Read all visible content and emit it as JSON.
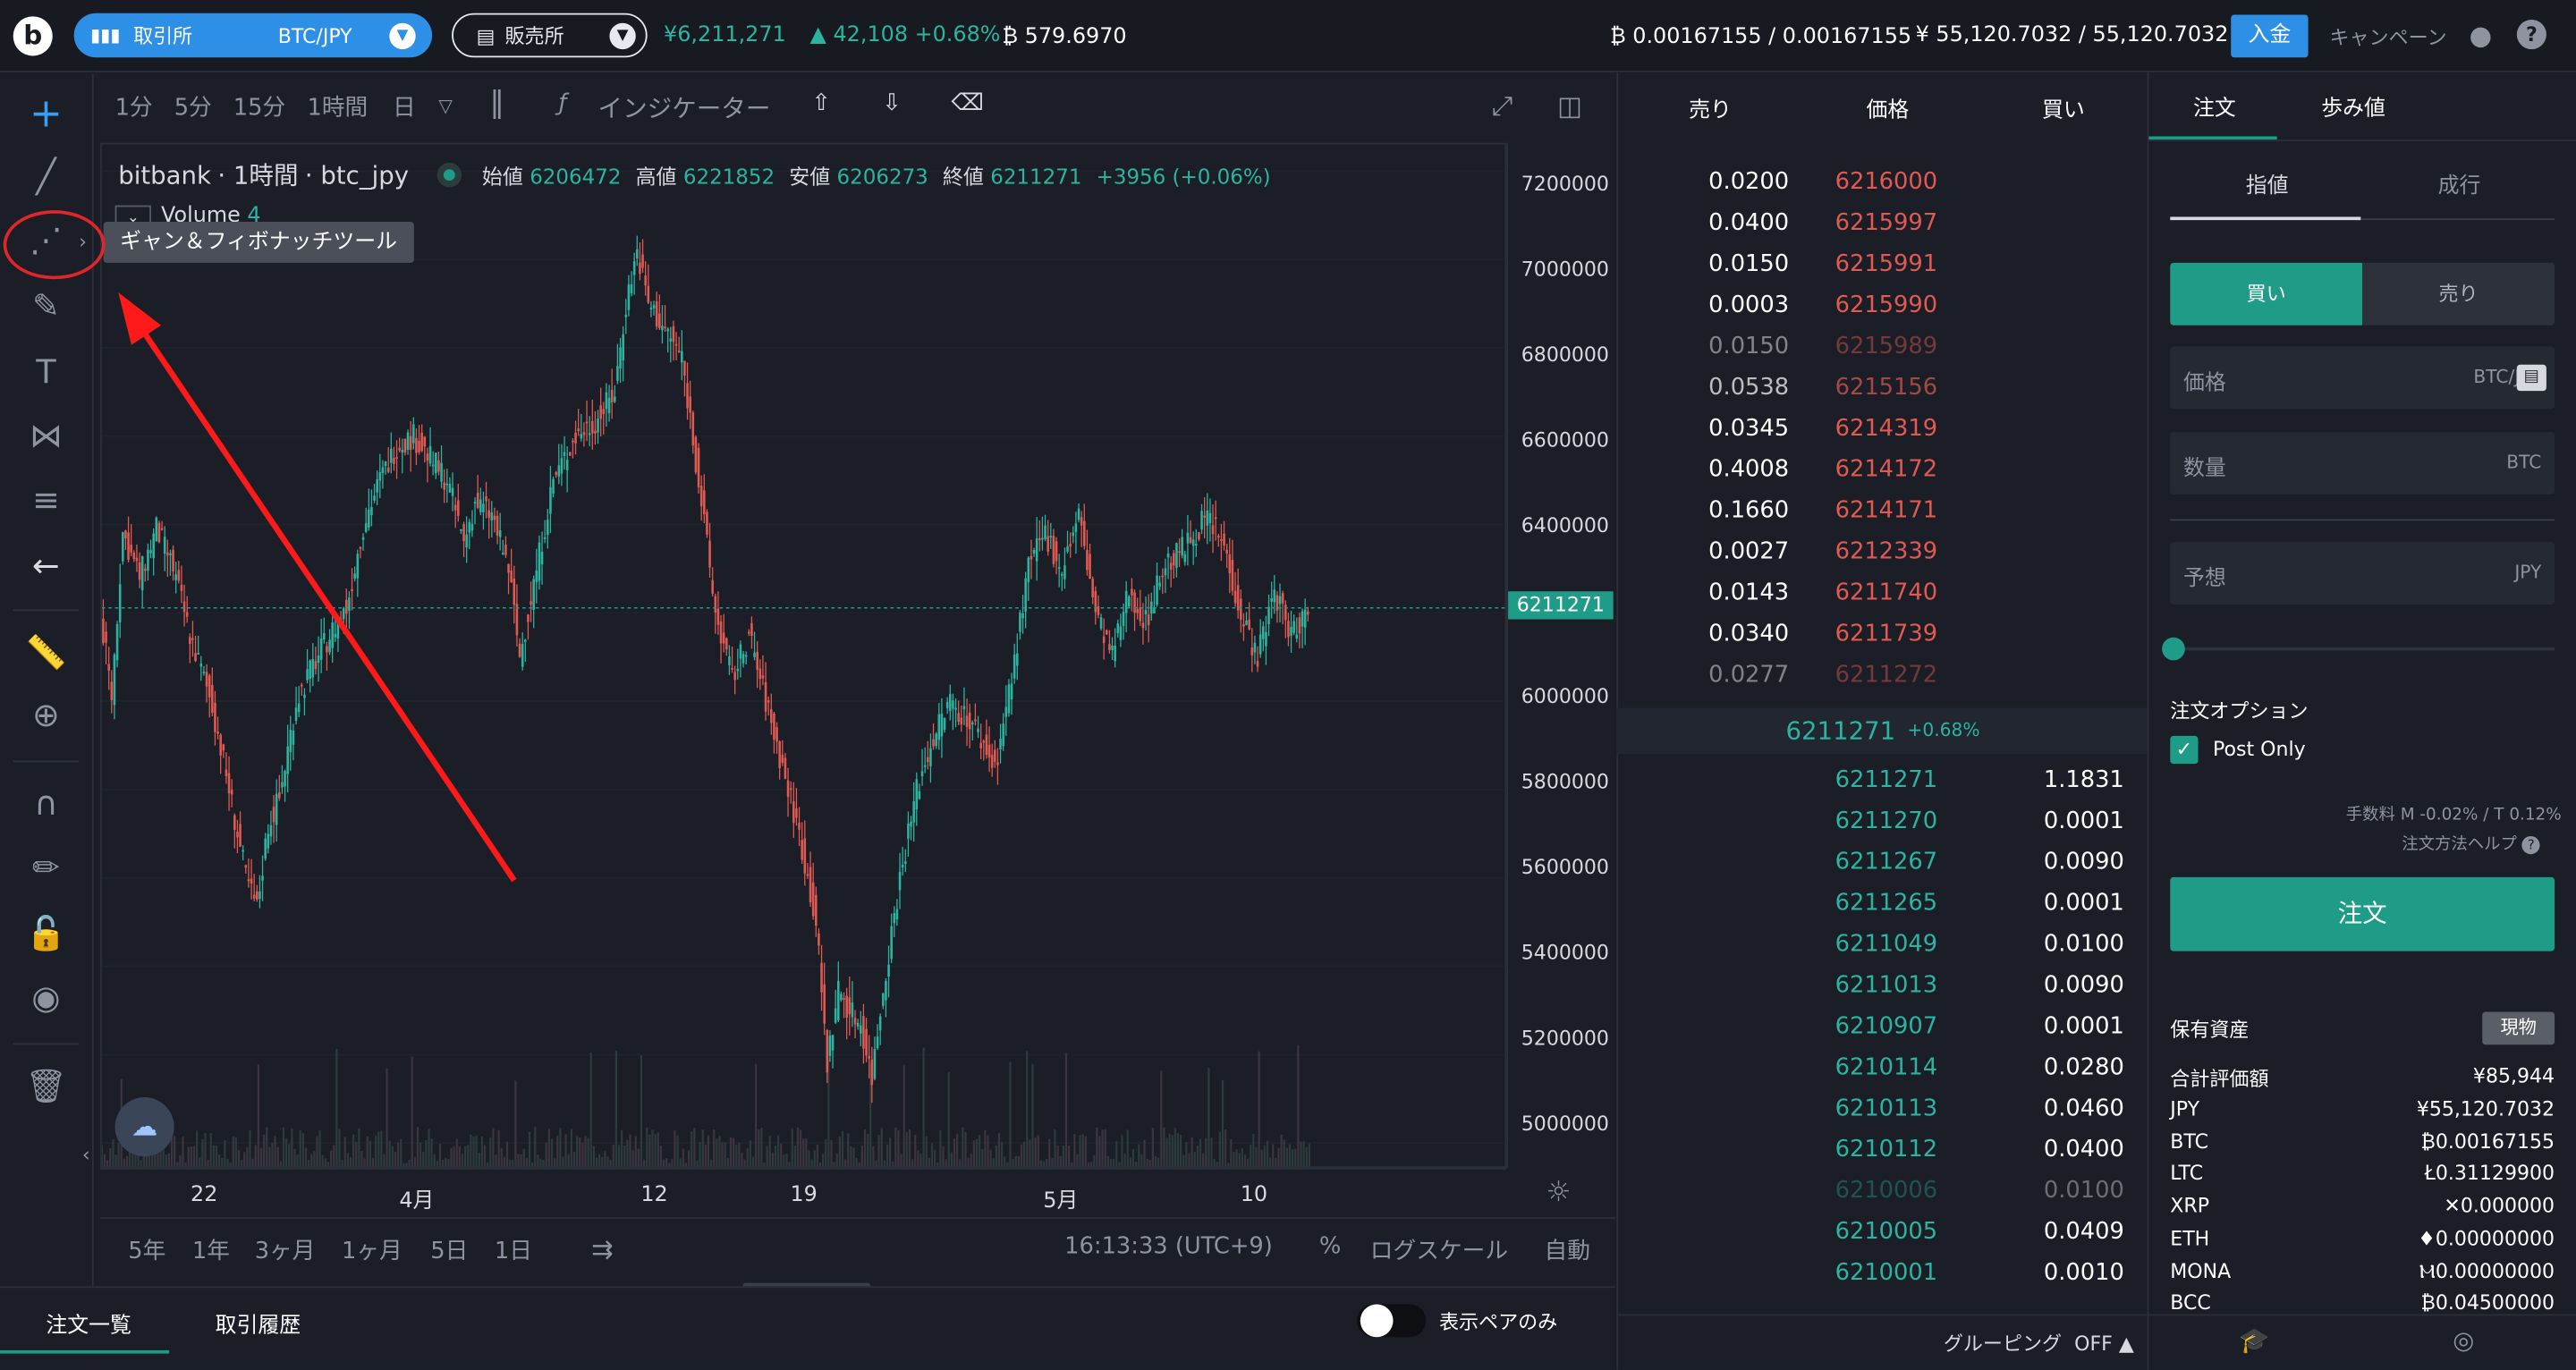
{
  "topbar": {
    "logo": "b",
    "exchange_label": "取引所",
    "pair": "BTC/JPY",
    "sales_label": "販売所",
    "price": "¥6,211,271",
    "change": "42,108 +0.68%",
    "volume": "579.6970",
    "btc_balance": "0.00167155 / 0.00167155",
    "jpy_balance": "55,120.7032 / 55,120.7032",
    "deposit": "入金",
    "campaign": "キャンペーン",
    "help": "?",
    "colors": {
      "accent": "#2e8fe6",
      "up": "#2bb4a0",
      "down": "#e05a52"
    }
  },
  "chart_header": {
    "intervals": [
      "1分",
      "5分",
      "15分",
      "1時間",
      "日"
    ],
    "active_interval": "1時間",
    "indicator": "インジケーター"
  },
  "chart": {
    "symbol": "bitbank",
    "interval": "1時間",
    "pair": "btc_jpy",
    "open_label": "始値",
    "open": "6206472",
    "high_label": "高値",
    "high": "6221852",
    "low_label": "安値",
    "low": "6206273",
    "close_label": "終値",
    "close": "6211271",
    "change": "+3956 (+0.06%)",
    "volume_label": "Volume",
    "volume_value": "4",
    "tooltip": "ギャン＆フィボナッチツール",
    "current_price": "6211271",
    "time": "16:13:33 (UTC+9)",
    "percent": "%",
    "log_scale": "ログスケール",
    "auto": "自動",
    "ranges": [
      "5年",
      "1年",
      "3ヶ月",
      "1ヶ月",
      "5日",
      "1日"
    ]
  },
  "chart_data": {
    "type": "candlestick",
    "price_ticks": [
      "7200000",
      "7000000",
      "6800000",
      "6600000",
      "6400000",
      "6200000",
      "6000000",
      "5800000",
      "5600000",
      "5400000",
      "5200000",
      "5000000"
    ],
    "time_ticks": [
      "22",
      "4月",
      "12",
      "19",
      "5月",
      "10"
    ],
    "ylim": [
      4940000,
      7260000
    ],
    "path": [
      [
        0,
        6200000
      ],
      [
        4,
        6010000
      ],
      [
        8,
        6380000
      ],
      [
        14,
        6280000
      ],
      [
        20,
        6390000
      ],
      [
        26,
        6300000
      ],
      [
        32,
        6150000
      ],
      [
        40,
        5990000
      ],
      [
        46,
        5800000
      ],
      [
        52,
        5600000
      ],
      [
        56,
        5530000
      ],
      [
        60,
        5720000
      ],
      [
        64,
        5780000
      ],
      [
        70,
        6000000
      ],
      [
        76,
        6080000
      ],
      [
        82,
        6150000
      ],
      [
        88,
        6210000
      ],
      [
        94,
        6400000
      ],
      [
        100,
        6500000
      ],
      [
        106,
        6580000
      ],
      [
        112,
        6600000
      ],
      [
        118,
        6550000
      ],
      [
        124,
        6500000
      ],
      [
        130,
        6360000
      ],
      [
        134,
        6450000
      ],
      [
        140,
        6420000
      ],
      [
        146,
        6300000
      ],
      [
        150,
        6100000
      ],
      [
        156,
        6300000
      ],
      [
        162,
        6500000
      ],
      [
        170,
        6600000
      ],
      [
        178,
        6640000
      ],
      [
        184,
        6700000
      ],
      [
        188,
        6900000
      ],
      [
        192,
        7020000
      ],
      [
        196,
        6900000
      ],
      [
        202,
        6840000
      ],
      [
        208,
        6780000
      ],
      [
        214,
        6500000
      ],
      [
        220,
        6200000
      ],
      [
        226,
        6050000
      ],
      [
        232,
        6150000
      ],
      [
        238,
        6000000
      ],
      [
        244,
        5850000
      ],
      [
        250,
        5700000
      ],
      [
        256,
        5500000
      ],
      [
        260,
        5180000
      ],
      [
        264,
        5350000
      ],
      [
        268,
        5300000
      ],
      [
        272,
        5270000
      ],
      [
        276,
        5150000
      ],
      [
        280,
        5350000
      ],
      [
        286,
        5600000
      ],
      [
        292,
        5800000
      ],
      [
        298,
        5920000
      ],
      [
        304,
        6000000
      ],
      [
        312,
        5950000
      ],
      [
        320,
        5850000
      ],
      [
        326,
        6050000
      ],
      [
        332,
        6300000
      ],
      [
        338,
        6380000
      ],
      [
        344,
        6300000
      ],
      [
        350,
        6420000
      ],
      [
        356,
        6200000
      ],
      [
        362,
        6100000
      ],
      [
        368,
        6250000
      ],
      [
        374,
        6180000
      ],
      [
        380,
        6300000
      ],
      [
        388,
        6350000
      ],
      [
        396,
        6420000
      ],
      [
        402,
        6350000
      ],
      [
        408,
        6200000
      ],
      [
        414,
        6100000
      ],
      [
        420,
        6250000
      ],
      [
        426,
        6150000
      ],
      [
        432,
        6211271
      ]
    ]
  },
  "orderbook": {
    "headers": [
      "売り",
      "価格",
      "買い"
    ],
    "asks": [
      {
        "amount": "0.0200",
        "price": "6216000"
      },
      {
        "amount": "0.0400",
        "price": "6215997"
      },
      {
        "amount": "0.0150",
        "price": "6215991"
      },
      {
        "amount": "0.0003",
        "price": "6215990"
      },
      {
        "amount": "0.0150",
        "price": "6215989"
      },
      {
        "amount": "0.0538",
        "price": "6215156"
      },
      {
        "amount": "0.0345",
        "price": "6214319"
      },
      {
        "amount": "0.4008",
        "price": "6214172"
      },
      {
        "amount": "0.1660",
        "price": "6214171"
      },
      {
        "amount": "0.0027",
        "price": "6212339"
      },
      {
        "amount": "0.0143",
        "price": "6211740"
      },
      {
        "amount": "0.0340",
        "price": "6211739"
      },
      {
        "amount": "0.0277",
        "price": "6211272"
      }
    ],
    "mid_price": "6211271",
    "mid_change": "+0.68%",
    "bids": [
      {
        "price": "6211271",
        "amount": "1.1831"
      },
      {
        "price": "6211270",
        "amount": "0.0001"
      },
      {
        "price": "6211267",
        "amount": "0.0090"
      },
      {
        "price": "6211265",
        "amount": "0.0001"
      },
      {
        "price": "6211049",
        "amount": "0.0100"
      },
      {
        "price": "6211013",
        "amount": "0.0090"
      },
      {
        "price": "6210907",
        "amount": "0.0001"
      },
      {
        "price": "6210114",
        "amount": "0.0280"
      },
      {
        "price": "6210113",
        "amount": "0.0460"
      },
      {
        "price": "6210112",
        "amount": "0.0400"
      },
      {
        "price": "6210006",
        "amount": "0.0100"
      },
      {
        "price": "6210005",
        "amount": "0.0409"
      },
      {
        "price": "6210001",
        "amount": "0.0010"
      }
    ],
    "grouping": "グルーピング",
    "grouping_state": "OFF"
  },
  "order_panel": {
    "tab_order": "注文",
    "tab_trades": "歩み値",
    "type_limit": "指値",
    "type_market": "成行",
    "buy": "買い",
    "sell": "売り",
    "price_label": "価格",
    "price_unit": "BTC/JPY",
    "qty_label": "数量",
    "qty_unit": "BTC",
    "estimate_label": "予想",
    "estimate_unit": "JPY",
    "options_label": "注文オプション",
    "post_only": "Post Only",
    "fee": "手数料 M -0.02% / T 0.12%",
    "order_help": "注文方法ヘルプ",
    "order_button": "注文",
    "assets_label": "保有資産",
    "spot": "現物",
    "total_label": "合計評価額",
    "total_value": "¥85,944",
    "balances": [
      {
        "name": "JPY",
        "value": "¥55,120.7032"
      },
      {
        "name": "BTC",
        "value": "₿0.00167155"
      },
      {
        "name": "LTC",
        "value": "Ł0.31129900"
      },
      {
        "name": "XRP",
        "value": "✕0.000000"
      },
      {
        "name": "ETH",
        "value": "♦0.00000000"
      },
      {
        "name": "MONA",
        "value": "Ⲙ0.00000000"
      },
      {
        "name": "BCC",
        "value": "₿0.04500000"
      }
    ]
  },
  "bottom": {
    "tab_orders": "注文一覧",
    "tab_history": "取引履歴",
    "pair_only": "表示ペアのみ"
  }
}
